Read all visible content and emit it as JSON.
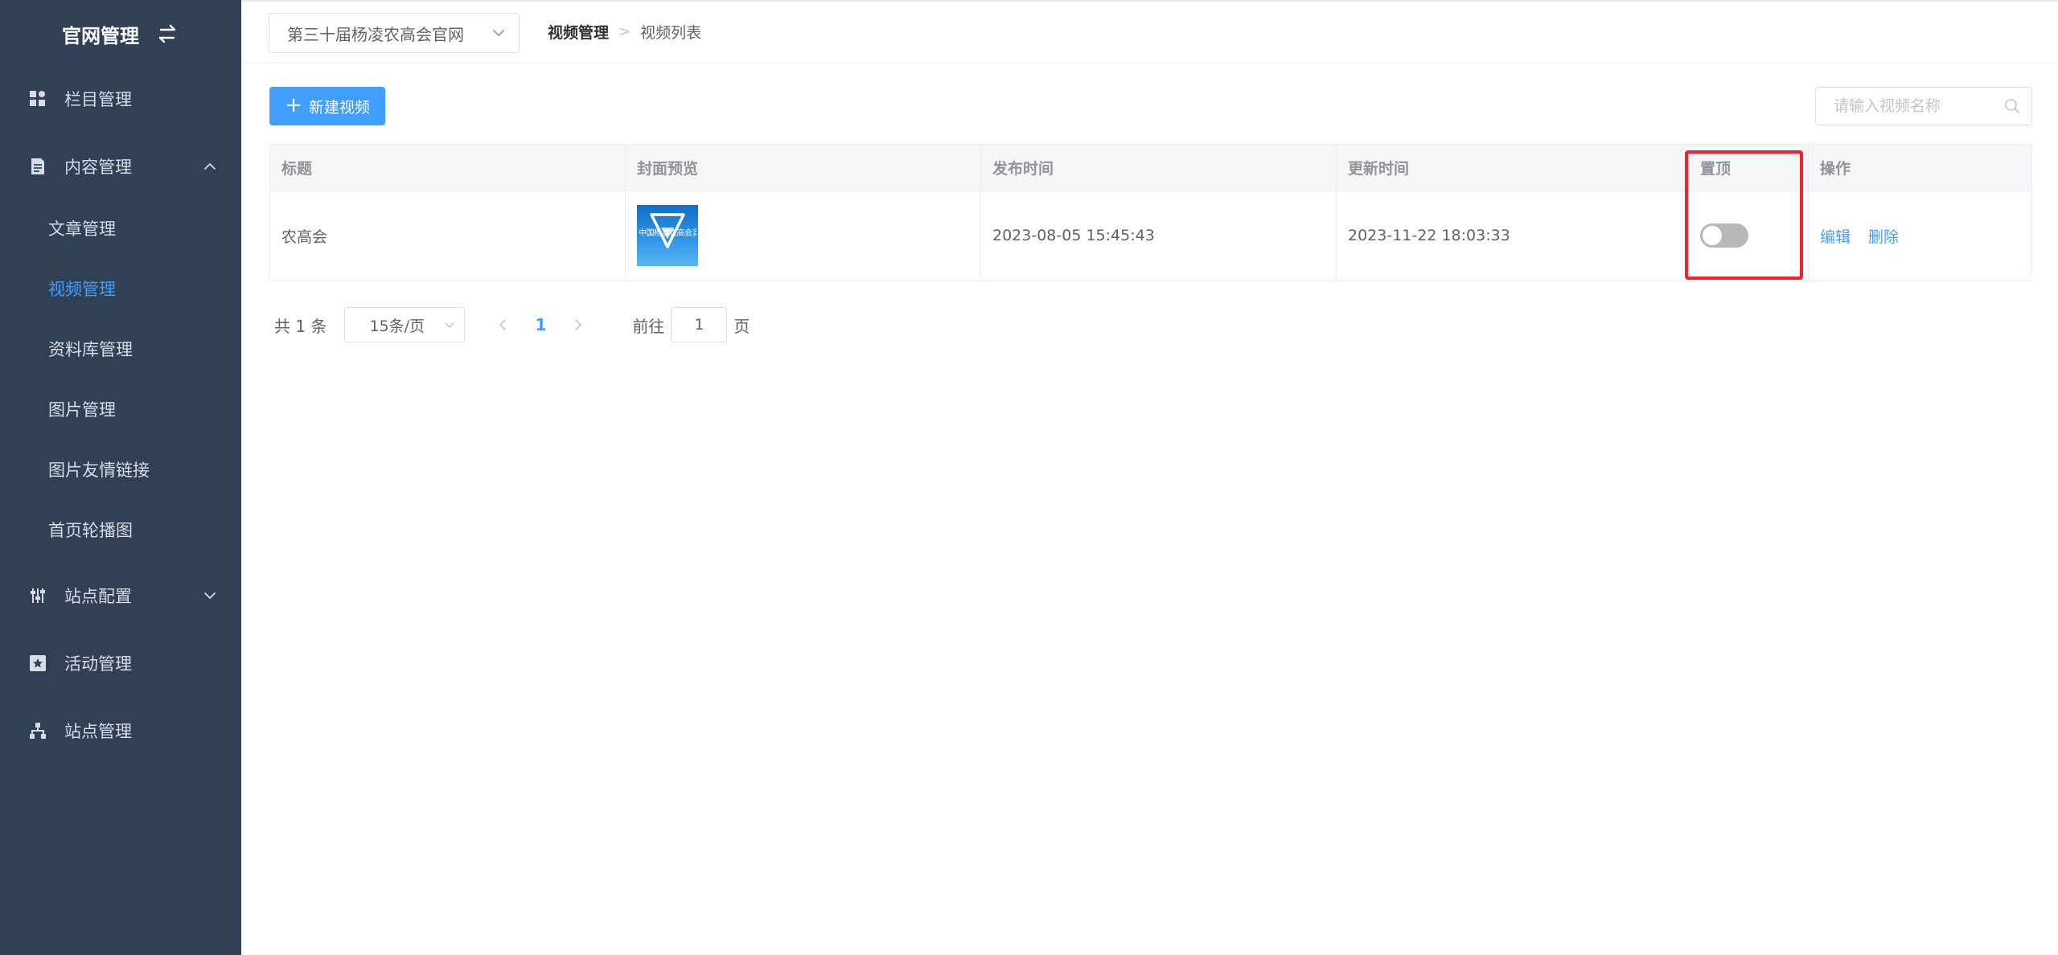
{
  "brand": {
    "title": "官网管理",
    "switch_icon": "swap-icon"
  },
  "sidebar": {
    "items": [
      {
        "label": "栏目管理",
        "icon": "grid-icon"
      },
      {
        "label": "内容管理",
        "icon": "document-icon",
        "expanded": true,
        "children": [
          {
            "label": "文章管理",
            "active": false
          },
          {
            "label": "视频管理",
            "active": true
          },
          {
            "label": "资料库管理",
            "active": false
          },
          {
            "label": "图片管理",
            "active": false
          },
          {
            "label": "图片友情链接",
            "active": false
          },
          {
            "label": "首页轮播图",
            "active": false
          }
        ]
      },
      {
        "label": "站点配置",
        "icon": "sliders-icon",
        "expanded": false
      },
      {
        "label": "活动管理",
        "icon": "star-box-icon"
      },
      {
        "label": "站点管理",
        "icon": "sitemap-icon"
      }
    ]
  },
  "header": {
    "site_select": "第三十届杨凌农高会官网",
    "breadcrumb": [
      "视频管理",
      "视频列表"
    ]
  },
  "toolbar": {
    "new_label": "新建视频",
    "search_placeholder": "请输入视频名称"
  },
  "table": {
    "columns": [
      "标题",
      "封面预览",
      "发布时间",
      "更新时间",
      "置顶",
      "操作"
    ],
    "rows": [
      {
        "title": "农高会",
        "cover_text": "中国杨凌农高会宣传片",
        "published": "2023-08-05 15:45:43",
        "updated": "2023-11-22 18:03:33",
        "pinned": false,
        "actions": [
          "编辑",
          "删除"
        ]
      }
    ]
  },
  "pagination": {
    "total": "共 1 条",
    "page_size": "15条/页",
    "current": "1",
    "goto_prefix": "前往",
    "goto_value": "1",
    "goto_suffix": "页"
  },
  "colors": {
    "sidebar_bg": "#304156",
    "accent": "#409eff",
    "highlight": "#f5222d"
  }
}
